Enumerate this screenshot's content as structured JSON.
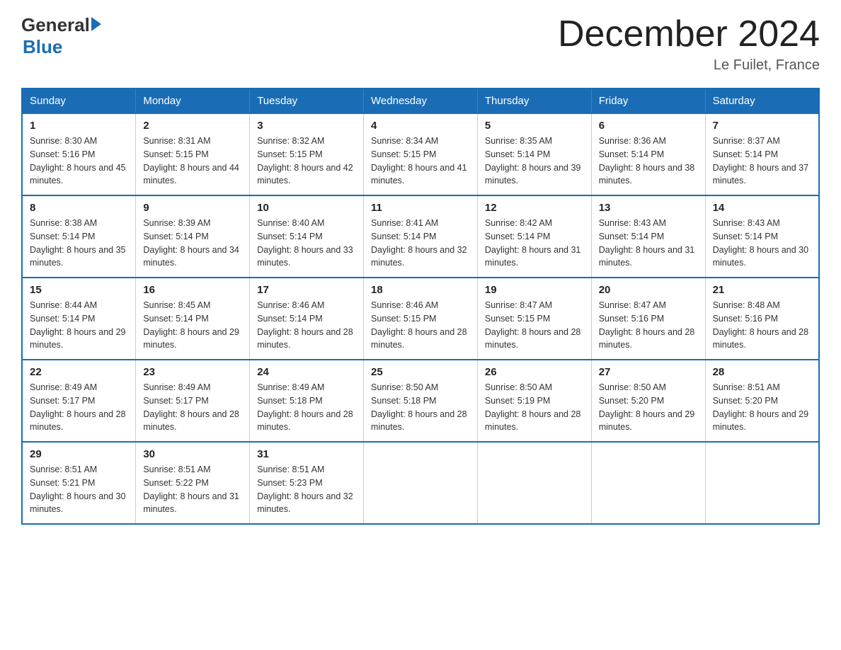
{
  "header": {
    "logo_general": "General",
    "logo_blue": "Blue",
    "month_title": "December 2024",
    "location": "Le Fuilet, France"
  },
  "days_of_week": [
    "Sunday",
    "Monday",
    "Tuesday",
    "Wednesday",
    "Thursday",
    "Friday",
    "Saturday"
  ],
  "weeks": [
    [
      {
        "day": "1",
        "sunrise": "Sunrise: 8:30 AM",
        "sunset": "Sunset: 5:16 PM",
        "daylight": "Daylight: 8 hours and 45 minutes."
      },
      {
        "day": "2",
        "sunrise": "Sunrise: 8:31 AM",
        "sunset": "Sunset: 5:15 PM",
        "daylight": "Daylight: 8 hours and 44 minutes."
      },
      {
        "day": "3",
        "sunrise": "Sunrise: 8:32 AM",
        "sunset": "Sunset: 5:15 PM",
        "daylight": "Daylight: 8 hours and 42 minutes."
      },
      {
        "day": "4",
        "sunrise": "Sunrise: 8:34 AM",
        "sunset": "Sunset: 5:15 PM",
        "daylight": "Daylight: 8 hours and 41 minutes."
      },
      {
        "day": "5",
        "sunrise": "Sunrise: 8:35 AM",
        "sunset": "Sunset: 5:14 PM",
        "daylight": "Daylight: 8 hours and 39 minutes."
      },
      {
        "day": "6",
        "sunrise": "Sunrise: 8:36 AM",
        "sunset": "Sunset: 5:14 PM",
        "daylight": "Daylight: 8 hours and 38 minutes."
      },
      {
        "day": "7",
        "sunrise": "Sunrise: 8:37 AM",
        "sunset": "Sunset: 5:14 PM",
        "daylight": "Daylight: 8 hours and 37 minutes."
      }
    ],
    [
      {
        "day": "8",
        "sunrise": "Sunrise: 8:38 AM",
        "sunset": "Sunset: 5:14 PM",
        "daylight": "Daylight: 8 hours and 35 minutes."
      },
      {
        "day": "9",
        "sunrise": "Sunrise: 8:39 AM",
        "sunset": "Sunset: 5:14 PM",
        "daylight": "Daylight: 8 hours and 34 minutes."
      },
      {
        "day": "10",
        "sunrise": "Sunrise: 8:40 AM",
        "sunset": "Sunset: 5:14 PM",
        "daylight": "Daylight: 8 hours and 33 minutes."
      },
      {
        "day": "11",
        "sunrise": "Sunrise: 8:41 AM",
        "sunset": "Sunset: 5:14 PM",
        "daylight": "Daylight: 8 hours and 32 minutes."
      },
      {
        "day": "12",
        "sunrise": "Sunrise: 8:42 AM",
        "sunset": "Sunset: 5:14 PM",
        "daylight": "Daylight: 8 hours and 31 minutes."
      },
      {
        "day": "13",
        "sunrise": "Sunrise: 8:43 AM",
        "sunset": "Sunset: 5:14 PM",
        "daylight": "Daylight: 8 hours and 31 minutes."
      },
      {
        "day": "14",
        "sunrise": "Sunrise: 8:43 AM",
        "sunset": "Sunset: 5:14 PM",
        "daylight": "Daylight: 8 hours and 30 minutes."
      }
    ],
    [
      {
        "day": "15",
        "sunrise": "Sunrise: 8:44 AM",
        "sunset": "Sunset: 5:14 PM",
        "daylight": "Daylight: 8 hours and 29 minutes."
      },
      {
        "day": "16",
        "sunrise": "Sunrise: 8:45 AM",
        "sunset": "Sunset: 5:14 PM",
        "daylight": "Daylight: 8 hours and 29 minutes."
      },
      {
        "day": "17",
        "sunrise": "Sunrise: 8:46 AM",
        "sunset": "Sunset: 5:14 PM",
        "daylight": "Daylight: 8 hours and 28 minutes."
      },
      {
        "day": "18",
        "sunrise": "Sunrise: 8:46 AM",
        "sunset": "Sunset: 5:15 PM",
        "daylight": "Daylight: 8 hours and 28 minutes."
      },
      {
        "day": "19",
        "sunrise": "Sunrise: 8:47 AM",
        "sunset": "Sunset: 5:15 PM",
        "daylight": "Daylight: 8 hours and 28 minutes."
      },
      {
        "day": "20",
        "sunrise": "Sunrise: 8:47 AM",
        "sunset": "Sunset: 5:16 PM",
        "daylight": "Daylight: 8 hours and 28 minutes."
      },
      {
        "day": "21",
        "sunrise": "Sunrise: 8:48 AM",
        "sunset": "Sunset: 5:16 PM",
        "daylight": "Daylight: 8 hours and 28 minutes."
      }
    ],
    [
      {
        "day": "22",
        "sunrise": "Sunrise: 8:49 AM",
        "sunset": "Sunset: 5:17 PM",
        "daylight": "Daylight: 8 hours and 28 minutes."
      },
      {
        "day": "23",
        "sunrise": "Sunrise: 8:49 AM",
        "sunset": "Sunset: 5:17 PM",
        "daylight": "Daylight: 8 hours and 28 minutes."
      },
      {
        "day": "24",
        "sunrise": "Sunrise: 8:49 AM",
        "sunset": "Sunset: 5:18 PM",
        "daylight": "Daylight: 8 hours and 28 minutes."
      },
      {
        "day": "25",
        "sunrise": "Sunrise: 8:50 AM",
        "sunset": "Sunset: 5:18 PM",
        "daylight": "Daylight: 8 hours and 28 minutes."
      },
      {
        "day": "26",
        "sunrise": "Sunrise: 8:50 AM",
        "sunset": "Sunset: 5:19 PM",
        "daylight": "Daylight: 8 hours and 28 minutes."
      },
      {
        "day": "27",
        "sunrise": "Sunrise: 8:50 AM",
        "sunset": "Sunset: 5:20 PM",
        "daylight": "Daylight: 8 hours and 29 minutes."
      },
      {
        "day": "28",
        "sunrise": "Sunrise: 8:51 AM",
        "sunset": "Sunset: 5:20 PM",
        "daylight": "Daylight: 8 hours and 29 minutes."
      }
    ],
    [
      {
        "day": "29",
        "sunrise": "Sunrise: 8:51 AM",
        "sunset": "Sunset: 5:21 PM",
        "daylight": "Daylight: 8 hours and 30 minutes."
      },
      {
        "day": "30",
        "sunrise": "Sunrise: 8:51 AM",
        "sunset": "Sunset: 5:22 PM",
        "daylight": "Daylight: 8 hours and 31 minutes."
      },
      {
        "day": "31",
        "sunrise": "Sunrise: 8:51 AM",
        "sunset": "Sunset: 5:23 PM",
        "daylight": "Daylight: 8 hours and 32 minutes."
      },
      null,
      null,
      null,
      null
    ]
  ]
}
